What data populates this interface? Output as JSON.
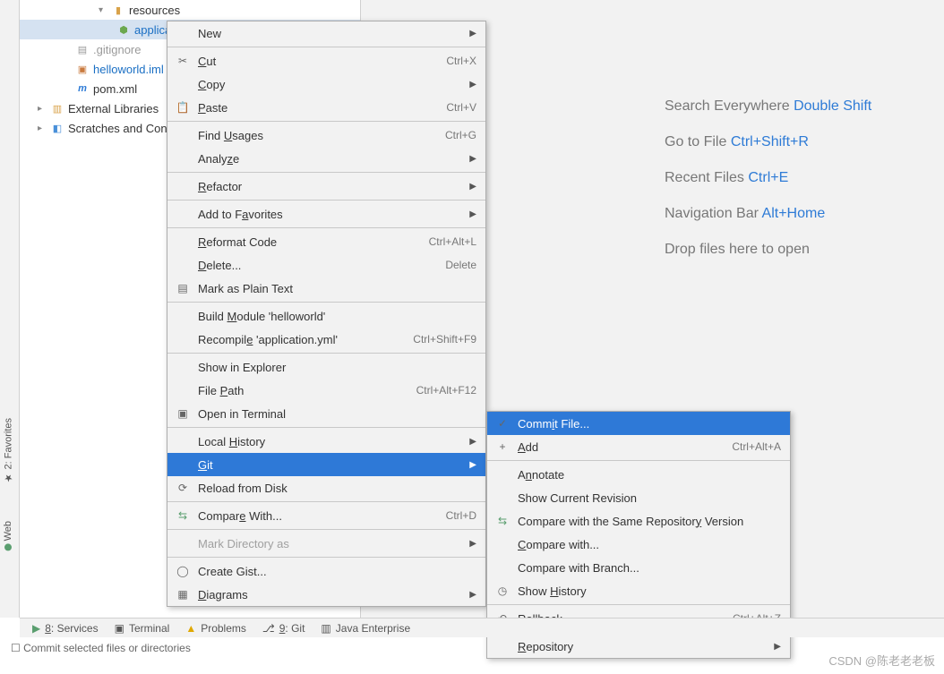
{
  "sideTabs": {
    "favorites": "2: Favorites",
    "web": "Web"
  },
  "tree": {
    "resources": "resources",
    "appyml": "application.yml",
    "gitignore": ".gitignore",
    "iml": "helloworld.iml",
    "pom": "pom.xml",
    "extlib": "External Libraries",
    "scratch": "Scratches and Con"
  },
  "welcome": {
    "l1a": "Search Everywhere ",
    "l1b": "Double Shift",
    "l2a": "Go to File ",
    "l2b": "Ctrl+Shift+R",
    "l3a": "Recent Files ",
    "l3b": "Ctrl+E",
    "l4a": "Navigation Bar ",
    "l4b": "Alt+Home",
    "l5": "Drop files here to open"
  },
  "menu1": {
    "new": "New",
    "cut": "Cut",
    "cut_k": "Ctrl+X",
    "copy": "Copy",
    "paste": "Paste",
    "paste_k": "Ctrl+V",
    "find": "Find Usages",
    "find_k": "Ctrl+G",
    "analyze": "Analyze",
    "refactor": "Refactor",
    "fav": "Add to Favorites",
    "reformat": "Reformat Code",
    "reformat_k": "Ctrl+Alt+L",
    "delete": "Delete...",
    "delete_k": "Delete",
    "plain": "Mark as Plain Text",
    "build": "Build Module 'helloworld'",
    "recompile": "Recompile 'application.yml'",
    "recompile_k": "Ctrl+Shift+F9",
    "explorer": "Show in Explorer",
    "filepath": "File Path",
    "filepath_k": "Ctrl+Alt+F12",
    "terminal": "Open in Terminal",
    "localhist": "Local History",
    "git": "Git",
    "reload": "Reload from Disk",
    "compare": "Compare With...",
    "compare_k": "Ctrl+D",
    "markdir": "Mark Directory as",
    "gist": "Create Gist...",
    "diagrams": "Diagrams"
  },
  "menu2": {
    "commit": "Commit File...",
    "add": "Add",
    "add_k": "Ctrl+Alt+A",
    "annotate": "Annotate",
    "showrev": "Show Current Revision",
    "cmpsame": "Compare with the Same Repository Version",
    "cmpwith": "Compare with...",
    "cmpbranch": "Compare with Branch...",
    "history": "Show History",
    "rollback": "Rollback...",
    "rollback_k": "Ctrl+Alt+Z",
    "repo": "Repository"
  },
  "bottom": {
    "services": "8: Services",
    "terminal": "Terminal",
    "problems": "Problems",
    "git": "9: Git",
    "javaee": "Java Enterprise"
  },
  "status": "Commit selected files or directories",
  "watermark": "CSDN @陈老老老板"
}
